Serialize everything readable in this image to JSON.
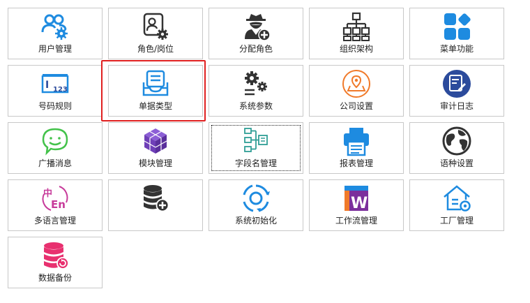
{
  "tiles": [
    {
      "label": "用户管理",
      "icon": "user-settings-icon"
    },
    {
      "label": "角色/岗位",
      "icon": "role-settings-icon"
    },
    {
      "label": "分配角色",
      "icon": "spy-add-icon"
    },
    {
      "label": "组织架构",
      "icon": "org-chart-icon"
    },
    {
      "label": "菜单功能",
      "icon": "menu-tiles-icon"
    },
    {
      "label": "号码规则",
      "icon": "number-rule-icon"
    },
    {
      "label": "单据类型",
      "icon": "document-tray-icon"
    },
    {
      "label": "系统参数",
      "icon": "gears-icon"
    },
    {
      "label": "公司设置",
      "icon": "location-pin-icon"
    },
    {
      "label": "审计日志",
      "icon": "audit-log-icon"
    },
    {
      "label": "广播消息",
      "icon": "chat-bubble-icon"
    },
    {
      "label": "模块管理",
      "icon": "cube-icon"
    },
    {
      "label": "字段名管理",
      "icon": "field-tree-icon"
    },
    {
      "label": "报表管理",
      "icon": "printer-icon"
    },
    {
      "label": "语种设置",
      "icon": "globe-icon"
    },
    {
      "label": "多语言管理",
      "icon": "zh-en-icon"
    },
    {
      "label": "",
      "icon": "database-add-icon"
    },
    {
      "label": "系统初始化",
      "icon": "refresh-cycle-icon"
    },
    {
      "label": "工作流管理",
      "icon": "workflow-w-icon"
    },
    {
      "label": "工厂管理",
      "icon": "house-gear-icon"
    },
    {
      "label": "数据备份",
      "icon": "database-backup-icon"
    }
  ],
  "colors": {
    "blue": "#1e8be0",
    "dark": "#333333",
    "teal": "#2f9e96",
    "orange": "#f07a2a",
    "navy": "#2c4b9c",
    "green": "#43c24a",
    "purple": "#6f3fb8",
    "pink": "#e8306f",
    "magenta": "#c73a9a",
    "highlight": "#e02020"
  }
}
